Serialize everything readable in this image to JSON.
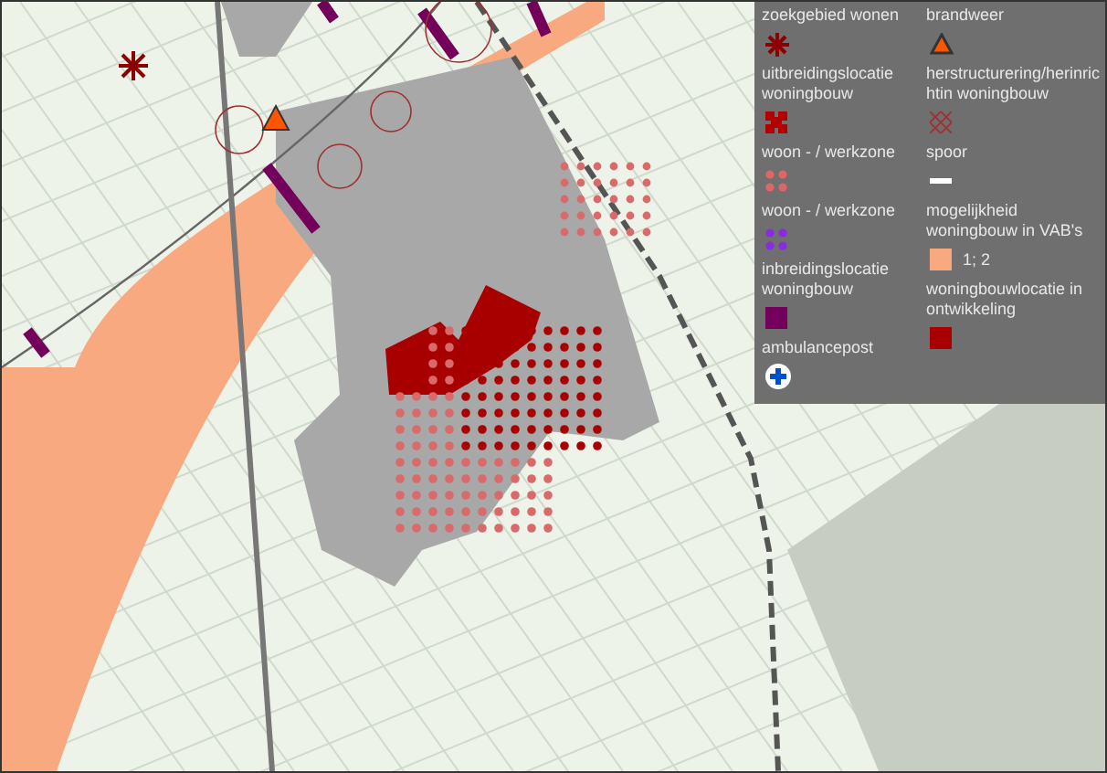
{
  "legend": {
    "columns": [
      {
        "items": [
          {
            "label": "zoekgebied wonen",
            "kind": "star",
            "color": "#8b0000"
          },
          {
            "label": "uitbreidingslocatie woningbouw",
            "kind": "blocks",
            "color": "#b30000"
          },
          {
            "label": "woon - / werkzone",
            "kind": "dots",
            "color": "#e06666"
          },
          {
            "label": "woon - / werkzone",
            "kind": "dots",
            "color": "#8a2be2"
          },
          {
            "label": "inbreidingslocatie woningbouw",
            "kind": "square",
            "color": "#73005a"
          },
          {
            "label": "ambulancepost",
            "kind": "cross",
            "color": "#0050c8"
          }
        ]
      },
      {
        "items": [
          {
            "label": "brandweer",
            "kind": "triangle",
            "color": "#ff5500"
          },
          {
            "label": "herstructurering/herinrichtin woningbouw",
            "kind": "hatch",
            "color": "#a03030"
          },
          {
            "label": "spoor",
            "kind": "line",
            "color": "#ffffff"
          },
          {
            "label": "mogelijkheid woningbouw in VAB's",
            "kind": "square",
            "color": "#f9a980",
            "value": "1; 2"
          },
          {
            "label": "woningbouwlocatie in ontwikkeling",
            "kind": "square",
            "color": "#a80000"
          }
        ]
      }
    ]
  }
}
